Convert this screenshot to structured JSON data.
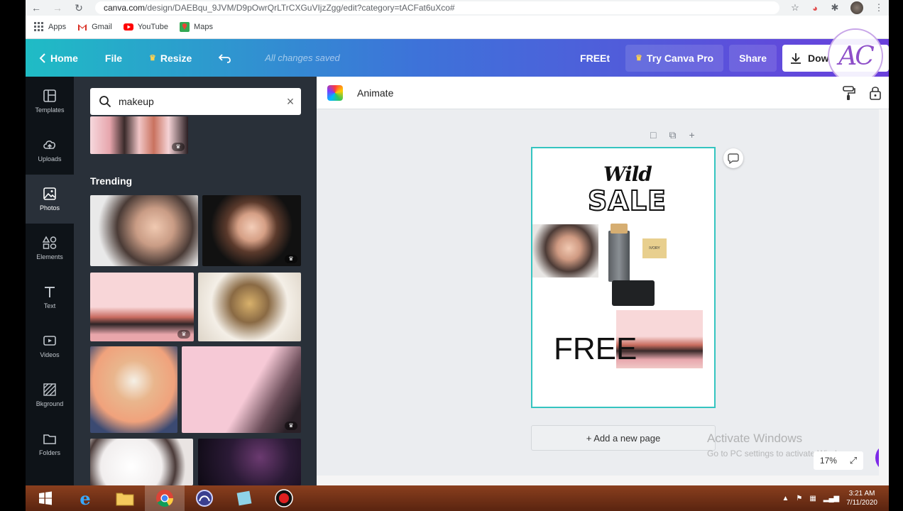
{
  "browser": {
    "url_domain": "canva.com",
    "url_path": "/design/DAEBqu_9JVM/D9pOwrQrLTrCXGuVIjzZgg/edit?category=tACFat6uXco#",
    "bookmarks": [
      "Apps",
      "Gmail",
      "YouTube",
      "Maps"
    ]
  },
  "topbar": {
    "home": "Home",
    "file": "File",
    "resize": "Resize",
    "status": "All changes saved",
    "design_title": "FREEt",
    "try_pro": "Try Canva Pro",
    "share": "Share",
    "download": "Dow",
    "overlay_logo": "AC"
  },
  "rail": {
    "items": [
      "Templates",
      "Uploads",
      "Photos",
      "Elements",
      "Text",
      "Videos",
      "Bkground",
      "Folders"
    ],
    "active": "Photos"
  },
  "panel": {
    "search_value": "makeup",
    "section_title": "Trending"
  },
  "editor": {
    "animate": "Animate",
    "add_page": "+ Add a new page",
    "zoom": "17%",
    "help": "?",
    "canvas": {
      "heading_script": "Wild",
      "heading_bold": "SALE",
      "big_text": "FREE",
      "product_label": "IVORY"
    }
  },
  "watermark": {
    "line1": "Activate Windows",
    "line2": "Go to PC settings to activate Windows."
  },
  "taskbar": {
    "time": "3:21 AM",
    "date": "7/11/2020"
  },
  "colors": {
    "gradient_start": "#1fbcc5",
    "gradient_end": "#6a3fdc",
    "selection": "#34c4c0",
    "help_purple": "#7d2ae8"
  }
}
